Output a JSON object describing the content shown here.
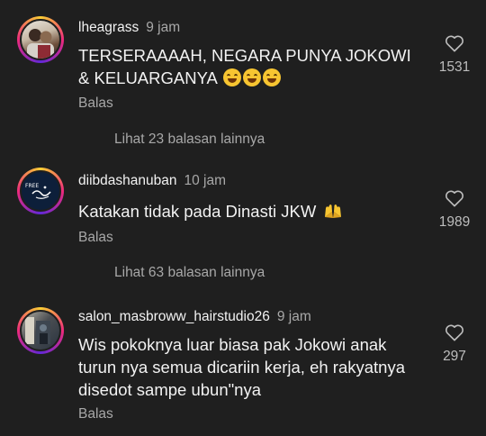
{
  "colors": {
    "background": "#1f1f1f",
    "primary_text": "#f2f2f2",
    "secondary_text": "#a8a8a8",
    "emoji_yellow": "#f7c531"
  },
  "comments": [
    {
      "username": "lheagrass",
      "time": "9 jam",
      "text": "TERSERAAAAH, NEGARA PUNYA JOKOWI & KELUARGANYA",
      "emojis": [
        "rofl-emoji",
        "joy-emoji",
        "rofl-emoji"
      ],
      "reply_label": "Balas",
      "likes": "1531",
      "view_replies": "Lihat 23 balasan lainnya"
    },
    {
      "username": "diibdashanuban",
      "time": "10 jam",
      "text": "Katakan tidak pada Dinasti JKW",
      "emojis": [
        "raised-hands-emoji"
      ],
      "reply_label": "Balas",
      "likes": "1989",
      "view_replies": "Lihat 63 balasan lainnya",
      "avatar_label": "FREE"
    },
    {
      "username": "salon_masbroww_hairstudio26",
      "time": "9 jam",
      "text": "Wis pokoknya luar biasa pak Jokowi anak turun nya semua dicariin kerja, eh rakyatnya disedot sampe ubun\"nya",
      "emojis": [],
      "reply_label": "Balas",
      "likes": "297"
    }
  ]
}
